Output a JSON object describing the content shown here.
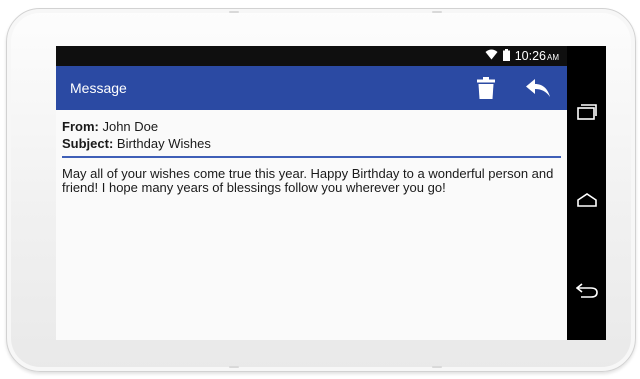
{
  "status_bar": {
    "time": "10:26",
    "ampm": "AM",
    "icons": [
      "wifi-icon",
      "battery-icon"
    ]
  },
  "app_bar": {
    "title": "Message",
    "actions": [
      "trash-icon",
      "reply-icon"
    ]
  },
  "message": {
    "from_label": "From:",
    "from_value": "John Doe",
    "subject_label": "Subject:",
    "subject_value": "Birthday Wishes",
    "body": "May all of your wishes come true this year. Happy Birthday to a wonderful person and friend! I hope many years of blessings follow you wherever you go!"
  },
  "nav_bar": {
    "buttons": [
      "recent-apps-icon",
      "home-icon",
      "back-icon"
    ]
  },
  "colors": {
    "app_bar": "#2b4aa3",
    "divider": "#3f5fb7",
    "status_bar": "#0f0f0f",
    "nav_bar": "#000000"
  }
}
